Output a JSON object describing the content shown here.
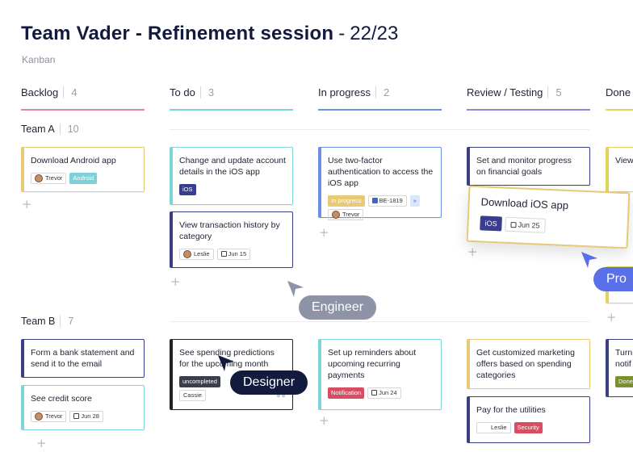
{
  "header": {
    "title_bold": "Team Vader - Refinement session",
    "title_sep": "-",
    "title_num": "22/23",
    "subtitle": "Kanban"
  },
  "columns": [
    {
      "label": "Backlog",
      "count": "4",
      "color": "#d98b9b"
    },
    {
      "label": "To do",
      "count": "3",
      "color": "#7dd4d9"
    },
    {
      "label": "In progress",
      "count": "2",
      "color": "#6b8fe0"
    },
    {
      "label": "Review / Testing",
      "count": "5",
      "color": "#9a83d6"
    },
    {
      "label": "Done",
      "count": "",
      "color": "#e2d35c"
    }
  ],
  "lanes": [
    {
      "label": "Team A",
      "count": "10"
    },
    {
      "label": "Team B",
      "count": "7"
    }
  ],
  "cards": {
    "a_backlog_1": {
      "title": "Download Android app",
      "person": "Trevor",
      "tag": "Android"
    },
    "a_todo_1": {
      "title": "Change and update account details in the iOS app",
      "tag": "iOS"
    },
    "a_todo_2": {
      "title": "View transaction history by category",
      "person": "Leslie",
      "date": "Jun 15"
    },
    "a_prog_1": {
      "title": "Use two-factor authentication to access the iOS app",
      "status": "In progress",
      "ticket": "BE-1819",
      "person": "Trevor"
    },
    "a_review_1": {
      "title": "Set and monitor progress on financial goals"
    },
    "a_done_1": {
      "title": "View"
    },
    "b_backlog_1": {
      "title": "Form a bank statement and send it to the email"
    },
    "b_backlog_2": {
      "title": "See credit score",
      "person": "Trevor",
      "date": "Jun 28"
    },
    "b_todo_1": {
      "title": "See spending predictions for the upcoming month",
      "tag": "uncompleted",
      "person": "Cassie"
    },
    "b_prog_1": {
      "title": "Set up reminders about upcoming recurring payments",
      "tag": "Notification",
      "date": "Jun 24"
    },
    "b_review_1": {
      "title": "Get customized marketing offers based on spending categories"
    },
    "b_review_2": {
      "title": "Pay for the utilities",
      "person": "Leslie",
      "tag": "Security"
    },
    "b_done_1": {
      "title": "Turn notif",
      "tag": "Done"
    }
  },
  "drag_card": {
    "title": "Download iOS app",
    "tag": "iOS",
    "date": "Jun 25"
  },
  "cursors": [
    {
      "label": "Engineer",
      "color": "#8f93a8"
    },
    {
      "label": "Designer",
      "color": "#121a3e"
    },
    {
      "label": "Pro",
      "color": "#5a70e8"
    }
  ],
  "add_symbol": "+"
}
